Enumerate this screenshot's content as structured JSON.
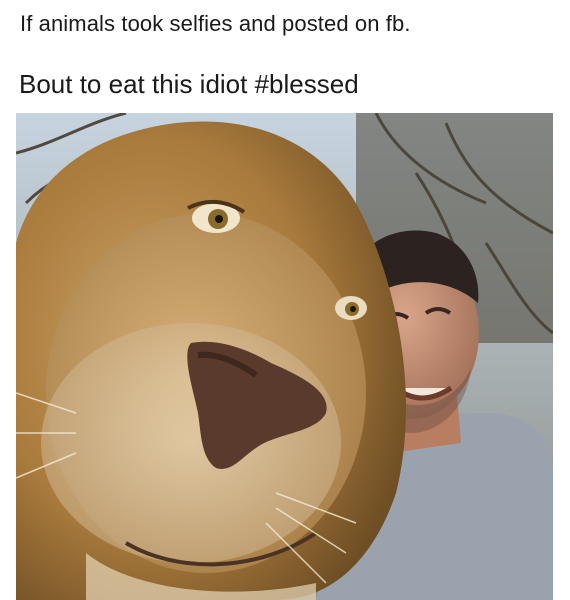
{
  "post": {
    "headline": "If animals took selfies and posted on fb.",
    "status_text": "Bout to eat this idiot #blessed"
  },
  "photo": {
    "subject": "lion and man selfie"
  },
  "colors": {
    "text": "#1a1a1a",
    "background": "#ffffff",
    "mane": "#b98a45",
    "sky": "#c9d6e2",
    "shirt": "#9aa3ad"
  }
}
